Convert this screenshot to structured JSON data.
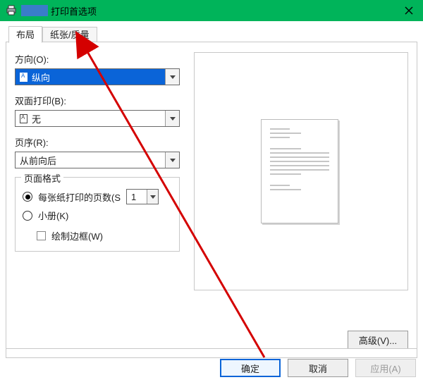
{
  "titlebar": {
    "title": "打印首选项"
  },
  "tabs": {
    "layout": "布局",
    "paper": "纸张/质量"
  },
  "orientation": {
    "label": "方向(O):",
    "value": "纵向"
  },
  "duplex": {
    "label": "双面打印(B):",
    "value": "无"
  },
  "order": {
    "label": "页序(R):",
    "value": "从前向后"
  },
  "pagefmt": {
    "legend": "页面格式",
    "pages_radio": "每张纸打印的页数(S",
    "pages_value": "1",
    "booklet_radio": "小册(K)",
    "border_check": "绘制边框(W)"
  },
  "advanced_btn": "高级(V)...",
  "buttons": {
    "ok": "确定",
    "cancel": "取消",
    "apply": "应用(A)"
  }
}
